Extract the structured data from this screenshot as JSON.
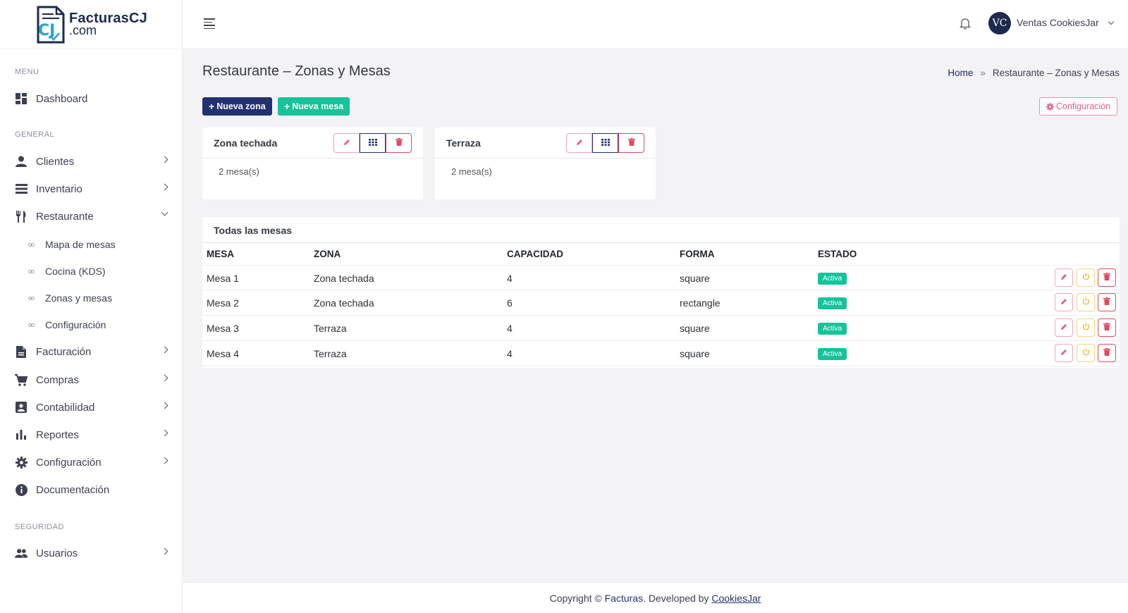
{
  "brand": {
    "name": "FacturasCJ",
    "suffix": ".com"
  },
  "sidebar": {
    "section_menu": "MENU",
    "section_general": "GENERAL",
    "section_security": "SEGURIDAD",
    "items": {
      "dashboard": "Dashboard",
      "clientes": "Clientes",
      "inventario": "Inventario",
      "restaurante": "Restaurante",
      "facturacion": "Facturación",
      "compras": "Compras",
      "contabilidad": "Contabilidad",
      "reportes": "Reportes",
      "configuracion": "Configuración",
      "documentacion": "Documentación",
      "usuarios": "Usuarios"
    },
    "restaurante_sub": {
      "mapa": "Mapa de mesas",
      "cocina": "Cocina (KDS)",
      "zonas": "Zonas y mesas",
      "config": "Configuración"
    }
  },
  "topbar": {
    "avatar_initials": "VC",
    "user_name": "Ventas CookiesJar"
  },
  "page": {
    "title": "Restaurante – Zonas y Mesas",
    "breadcrumb_home": "Home",
    "breadcrumb_sep": "»",
    "breadcrumb_current": "Restaurante – Zonas y Mesas",
    "btn_nueva_zona": "Nueva zona",
    "btn_nueva_mesa": "Nueva mesa",
    "btn_configuracion": "Configuración"
  },
  "zones": [
    {
      "name": "Zona techada",
      "count": "2 mesa(s)"
    },
    {
      "name": "Terraza",
      "count": "2 mesa(s)"
    }
  ],
  "table": {
    "title": "Todas las mesas",
    "headers": {
      "mesa": "MESA",
      "zona": "ZONA",
      "capacidad": "CAPACIDAD",
      "forma": "FORMA",
      "estado": "ESTADO"
    },
    "rows": [
      {
        "mesa": "Mesa 1",
        "zona": "Zona techada",
        "capacidad": "4",
        "forma": "square",
        "estado": "Activa"
      },
      {
        "mesa": "Mesa 2",
        "zona": "Zona techada",
        "capacidad": "6",
        "forma": "rectangle",
        "estado": "Activa"
      },
      {
        "mesa": "Mesa 3",
        "zona": "Terraza",
        "capacidad": "4",
        "forma": "square",
        "estado": "Activa"
      },
      {
        "mesa": "Mesa 4",
        "zona": "Terraza",
        "capacidad": "4",
        "forma": "square",
        "estado": "Activa"
      }
    ]
  },
  "footer": {
    "prefix": "Copyright ©",
    "brand": "Facturas",
    "middle": ". Developed by",
    "dev": "CookiesJar"
  },
  "colors": {
    "primary": "#233173",
    "success": "#16c39a",
    "danger": "#e04a5f",
    "warning": "#e8b92c",
    "pink": "#e0608a"
  }
}
